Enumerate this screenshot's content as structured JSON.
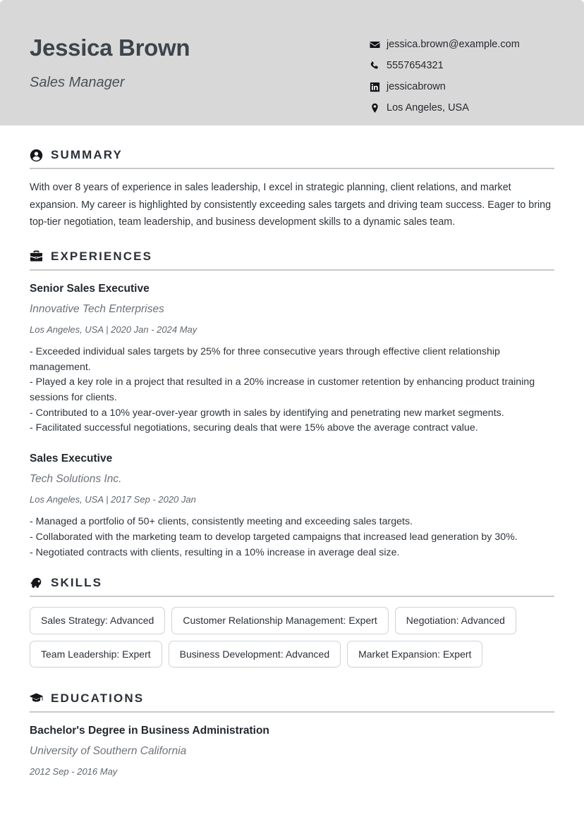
{
  "header": {
    "name": "Jessica Brown",
    "job_title": "Sales Manager",
    "contacts": [
      {
        "icon": "email-icon",
        "value": "jessica.brown@example.com"
      },
      {
        "icon": "phone-icon",
        "value": "5557654321"
      },
      {
        "icon": "linkedin-icon",
        "value": "jessicabrown"
      },
      {
        "icon": "location-icon",
        "value": "Los Angeles, USA"
      }
    ]
  },
  "sections": {
    "summary": {
      "title": "SUMMARY",
      "icon": "person-circle-icon",
      "text": "With over 8 years of experience in sales leadership, I excel in strategic planning, client relations, and market expansion. My career is highlighted by consistently exceeding sales targets and driving team success. Eager to bring top-tier negotiation, team leadership, and business development skills to a dynamic sales team."
    },
    "experiences": {
      "title": "EXPERIENCES",
      "icon": "briefcase-icon",
      "items": [
        {
          "role": "Senior Sales Executive",
          "organization": "Innovative Tech Enterprises",
          "meta": "Los Angeles, USA  |  2020 Jan - 2024 May",
          "bullets": [
            "- Exceeded individual sales targets by 25% for three consecutive years through effective client relationship management.",
            "- Played a key role in a project that resulted in a 20% increase in customer retention by enhancing product training sessions for clients.",
            "- Contributed to a 10% year-over-year growth in sales by identifying and penetrating new market segments.",
            "- Facilitated successful negotiations, securing deals that were 15% above the average contract value."
          ]
        },
        {
          "role": "Sales Executive",
          "organization": "Tech Solutions Inc.",
          "meta": "Los Angeles, USA  |  2017 Sep - 2020 Jan",
          "bullets": [
            "- Managed a portfolio of 50+ clients, consistently meeting and exceeding sales targets.",
            "- Collaborated with the marketing team to develop targeted campaigns that increased lead generation by 30%.",
            "- Negotiated contracts with clients, resulting in a 10% increase in average deal size."
          ]
        }
      ]
    },
    "skills": {
      "title": "SKILLS",
      "icon": "brain-head-icon",
      "items": [
        "Sales Strategy: Advanced",
        "Customer Relationship Management: Expert",
        "Negotiation: Advanced",
        "Team Leadership: Expert",
        "Business Development: Advanced",
        "Market Expansion: Expert"
      ]
    },
    "educations": {
      "title": "EDUCATIONS",
      "icon": "graduation-cap-icon",
      "items": [
        {
          "degree": "Bachelor's Degree in Business Administration",
          "institution": "University of Southern California",
          "meta": "2012 Sep - 2016 May"
        }
      ]
    }
  },
  "colors": {
    "header_band": "#d8d8d8",
    "name_text": "#3d444c",
    "body_text": "#2f343b",
    "muted_text": "#6d737b",
    "divider": "#c9c9c9",
    "chip_border": "#cfd2d6",
    "page_background": "#ffffff"
  }
}
